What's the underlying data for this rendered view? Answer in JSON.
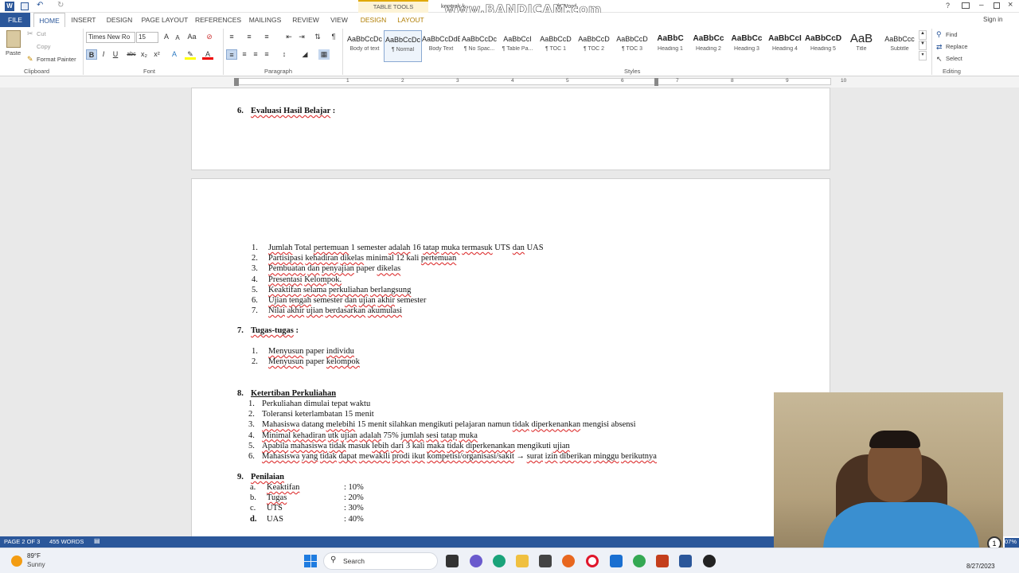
{
  "window": {
    "contextual_tab_group": "TABLE TOOLS",
    "title_partial": "kontrak k...",
    "title_suffix": "ft Word",
    "sign_in": "Sign in",
    "watermark": "www.BANDICAM.com"
  },
  "tabs": [
    "FILE",
    "HOME",
    "INSERT",
    "DESIGN",
    "PAGE LAYOUT",
    "REFERENCES",
    "MAILINGS",
    "REVIEW",
    "VIEW",
    "DESIGN",
    "LAYOUT"
  ],
  "clipboard": {
    "paste": "Paste",
    "cut": "Cut",
    "copy": "Copy",
    "format_painter": "Format Painter",
    "label": "Clipboard"
  },
  "font": {
    "name": "Times New Ro",
    "size": "15",
    "label": "Font"
  },
  "paragraph": {
    "label": "Paragraph"
  },
  "styles": {
    "label": "Styles",
    "items": [
      {
        "preview": "AaBbCcDc",
        "name": "Body of text"
      },
      {
        "preview": "AaBbCcDc",
        "name": "¶ Normal"
      },
      {
        "preview": "AaBbCcDdE",
        "name": "Body Text"
      },
      {
        "preview": "AaBbCcDc",
        "name": "¶ No Spac..."
      },
      {
        "preview": "AaBbCcI",
        "name": "¶ Table Pa..."
      },
      {
        "preview": "AaBbCcD",
        "name": "¶ TOC 1"
      },
      {
        "preview": "AaBbCcD",
        "name": "¶ TOC 2"
      },
      {
        "preview": "AaBbCcD",
        "name": "¶ TOC 3"
      },
      {
        "preview": "AaBbC",
        "name": "Heading 1"
      },
      {
        "preview": "AaBbCc",
        "name": "Heading 2"
      },
      {
        "preview": "AaBbCc",
        "name": "Heading 3"
      },
      {
        "preview": "AaBbCcI",
        "name": "Heading 4"
      },
      {
        "preview": "AaBbCcD",
        "name": "Heading 5"
      },
      {
        "preview": "AaB",
        "name": "Title"
      },
      {
        "preview": "AaBbCcc",
        "name": "Subtitle"
      }
    ]
  },
  "editing": {
    "find": "Find",
    "replace": "Replace",
    "select": "Select",
    "label": "Editing"
  },
  "ruler": {
    "marks": [
      "1",
      "2",
      "3",
      "4",
      "5",
      "6",
      "7",
      "8",
      "9",
      "10"
    ]
  },
  "document": {
    "section6": {
      "num": "6.",
      "title": "Evaluasi Hasil Belajar",
      ":": ":"
    },
    "list1": [
      "Jumlah Total pertemuan 1 semester adalah 16 tatap muka termasuk UTS dan UAS",
      "Partisipasi kehadiran dikelas minimal 12 kali pertemuan",
      "Pembuatan dan penyajian paper dikelas",
      "Presentasi Kelompok.",
      "Keaktifan selama perkuliahan berlangsung",
      "Ujian tengah semester dan ujian akhir semester",
      "Nilai akhir ujian berdasarkan akumulasi"
    ],
    "section7": {
      "num": "7.",
      "title": "Tugas-tugas",
      ":": ":"
    },
    "list2": [
      "Menyusun paper individu",
      "Menyusun paper kelompok"
    ],
    "section8": {
      "num": "8.",
      "title": "Ketertiban Perkuliahan"
    },
    "list3": [
      "Perkuliahan dimulai tepat waktu",
      "Toleransi keterlambatan 15 menit",
      "Mahasiswa datang melebihi 15 menit silahkan mengikuti pelajaran namun tidak diperkenankan mengisi absensi",
      "Minimal kehadiran utk ujian adalah 75% jumlah sesi tatap muka",
      "Apabila mahasiswa tidak masuk lebih dari 3 kali maka tidak diperkenankan mengikuti ujian",
      "Mahasiswa yang tidak dapat mewakili prodi ikut kompetisi/organisasi/sakit → surat izin diberikan minggu berikutnya"
    ],
    "section9": {
      "num": "9.",
      "title": "Penilaian"
    },
    "grading": [
      {
        "letter": "a.",
        "item": "Keaktifan",
        "value": ": 10%"
      },
      {
        "letter": "b.",
        "item": "Tugas",
        "value": ": 20%"
      },
      {
        "letter": "c.",
        "item": "UTS",
        "value": ": 30%"
      },
      {
        "letter": "d.",
        "item": "UAS",
        "value": ": 40%"
      }
    ]
  },
  "statusbar": {
    "page": "PAGE 2 OF 3",
    "words": "455 WORDS",
    "zoom": "07%"
  },
  "taskbar": {
    "weather_temp": "89°F",
    "weather_desc": "Sunny",
    "search": "Search",
    "date": "8/27/2023"
  },
  "webcam": {
    "badge": "1"
  }
}
